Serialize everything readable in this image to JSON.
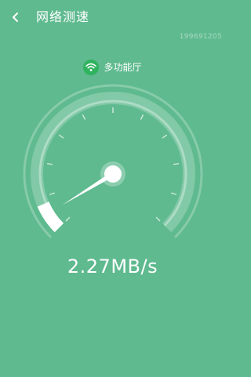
{
  "header": {
    "title": "网络测速",
    "back_icon": "chevron-left-icon"
  },
  "watermark": "199691205",
  "network": {
    "icon": "wifi-icon",
    "ssid": "多功能厅"
  },
  "speedometer": {
    "value_text": "2.27MB/s",
    "needle_fraction": 0.05,
    "fill_fraction": 0.08
  },
  "colors": {
    "background": "#5fba8f",
    "wifi_badge": "#2fb35f",
    "text": "#ffffff"
  }
}
